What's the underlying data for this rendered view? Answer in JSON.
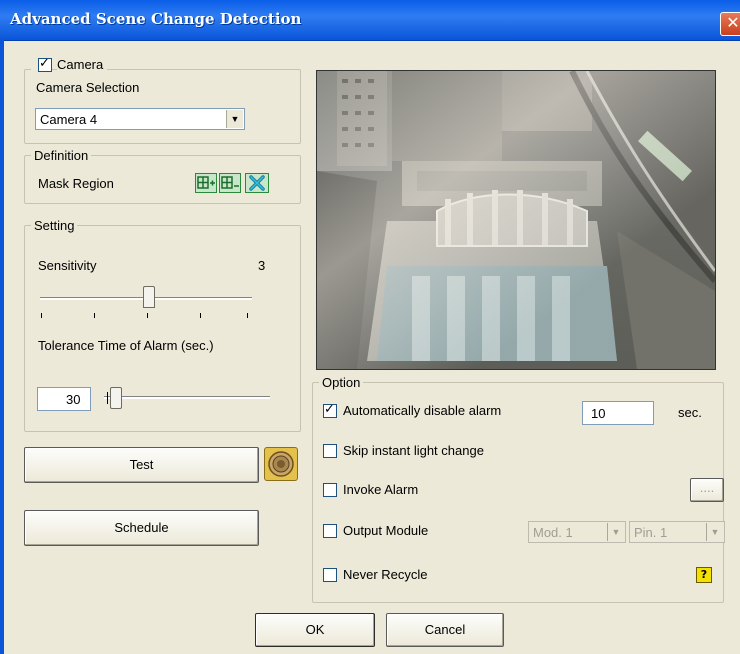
{
  "window": {
    "title": "Advanced Scene Change Detection",
    "close_glyph": "✕"
  },
  "camera": {
    "group_label": "Camera",
    "checked": true,
    "selection_label": "Camera Selection",
    "selected": "Camera 4"
  },
  "definition": {
    "group_label": "Definition",
    "mask_label": "Mask Region"
  },
  "setting": {
    "group_label": "Setting",
    "sensitivity_label": "Sensitivity",
    "sensitivity_value": "3",
    "tolerance_label": "Tolerance Time of Alarm (sec.)",
    "tolerance_value": "30"
  },
  "buttons": {
    "test": "Test",
    "schedule": "Schedule",
    "ok": "OK",
    "cancel": "Cancel",
    "browse": "...."
  },
  "option": {
    "group_label": "Option",
    "auto_disable_label": "Automatically disable alarm",
    "auto_disable_checked": true,
    "auto_disable_value": "10",
    "sec_label": "sec.",
    "skip_light_label": "Skip instant light change",
    "invoke_alarm_label": "Invoke Alarm",
    "output_module_label": "Output Module",
    "module_value": "Mod. 1",
    "pin_value": "Pin. 1",
    "never_recycle_label": "Never Recycle"
  },
  "help_glyph": "?",
  "colors": {
    "title_bar": "#0a5ee8",
    "dialog_bg": "#ece9d8",
    "mask_green": "#2a8a3c"
  }
}
